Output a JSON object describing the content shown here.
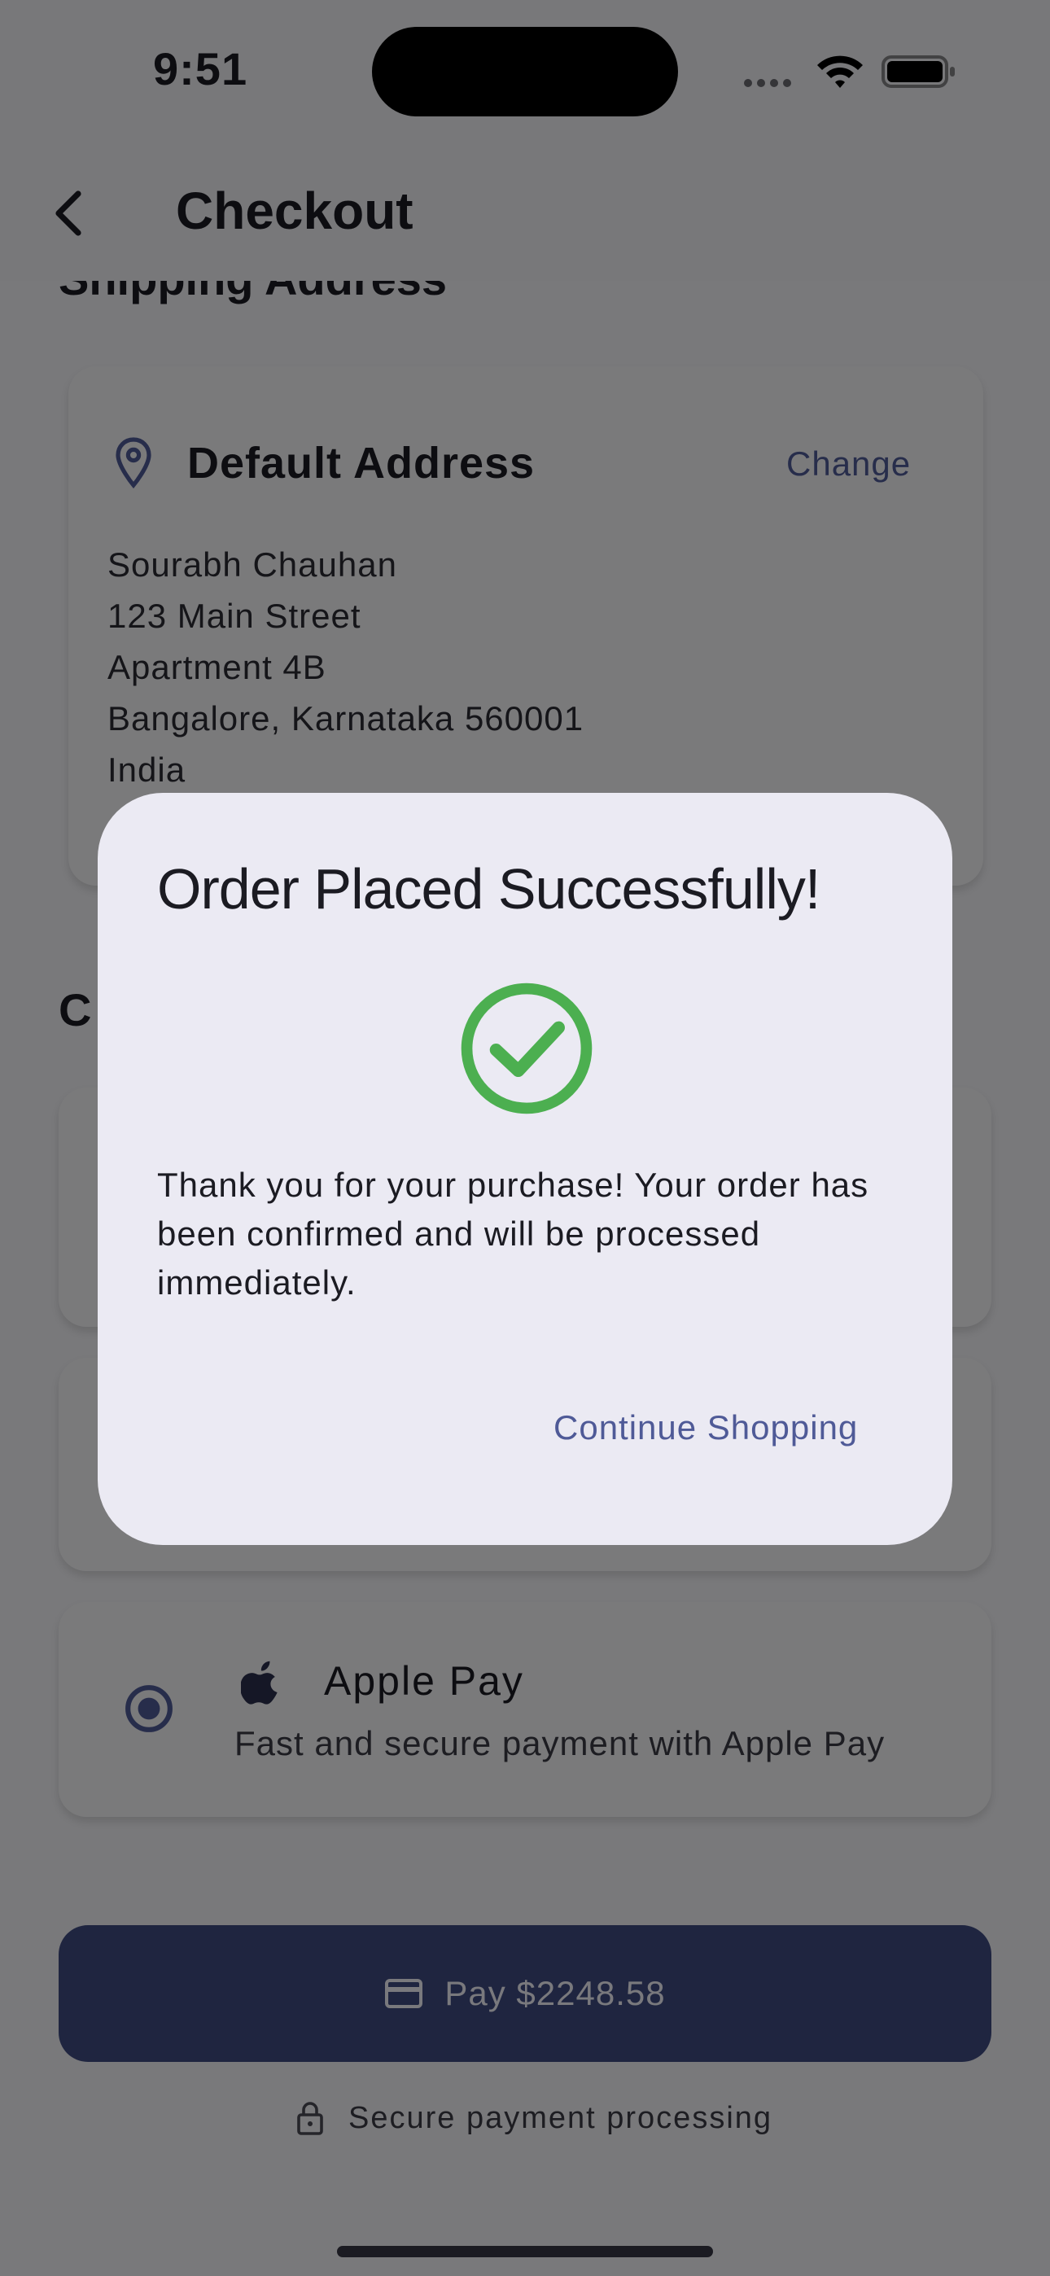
{
  "status_bar": {
    "time": "9:51"
  },
  "header": {
    "title": "Checkout"
  },
  "shipping": {
    "section_title": "Shipping Address",
    "card_title": "Default Address",
    "change_label": "Change",
    "lines": [
      "Sourabh Chauhan",
      "123 Main Street",
      "Apartment 4B",
      "Bangalore, Karnataka 560001",
      "India"
    ]
  },
  "payment": {
    "section_title": "C",
    "apple_pay": {
      "title": "Apple Pay",
      "description": "Fast and secure payment with Apple Pay",
      "selected": true
    }
  },
  "pay_button": {
    "label": "Pay $2248.58"
  },
  "secure_note": "Secure payment processing",
  "dialog": {
    "title": "Order Placed Successfully!",
    "message": "Thank you for your purchase! Your order has been confirmed and will be processed immediately.",
    "button_label": "Continue Shopping"
  },
  "colors": {
    "accent": "#4f5a97",
    "pay_button": "#3f4a80",
    "success": "#4caf50",
    "dialog_bg": "#ebeaf3"
  }
}
